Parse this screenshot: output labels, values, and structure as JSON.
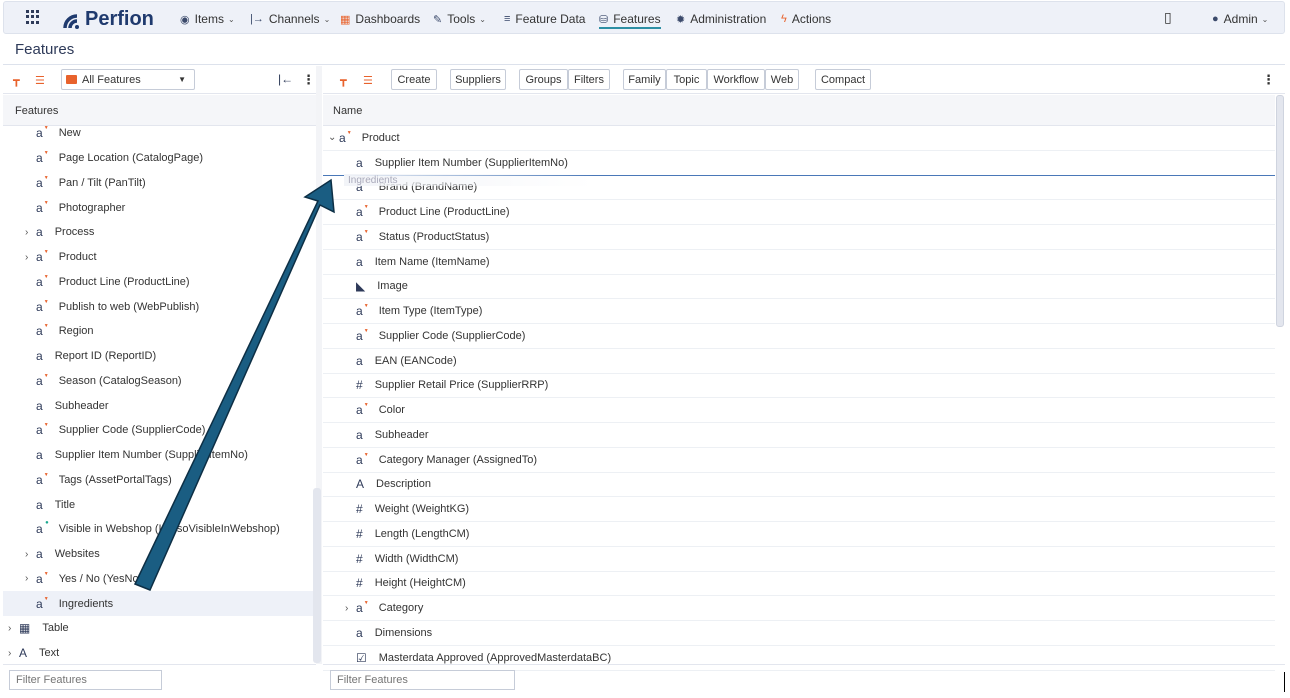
{
  "nav": {
    "brand": "Perfion",
    "items": [
      {
        "label": "Items",
        "icon": "cube-icon"
      },
      {
        "label": "Channels",
        "icon": "channel-icon"
      },
      {
        "label": "Dashboards",
        "icon": "dashboard-icon"
      },
      {
        "label": "Tools",
        "icon": "wrench-icon"
      },
      {
        "label": "Feature Data",
        "icon": "list-icon"
      },
      {
        "label": "Features",
        "icon": "database-icon"
      },
      {
        "label": "Administration",
        "icon": "gear-icon"
      },
      {
        "label": "Actions",
        "icon": "lightning-icon"
      }
    ],
    "user": "Admin"
  },
  "page_title": "Features",
  "left": {
    "select_value": "All Features",
    "column_header": "Features",
    "items": [
      {
        "label": "New",
        "icon": "a",
        "dd": true
      },
      {
        "label": "Page Location (CatalogPage)",
        "icon": "a",
        "dd": true
      },
      {
        "label": "Pan / Tilt (PanTilt)",
        "icon": "a",
        "dd": true
      },
      {
        "label": "Photographer",
        "icon": "a",
        "dd": true
      },
      {
        "label": "Process",
        "icon": "a",
        "chev": true
      },
      {
        "label": "Product",
        "icon": "a",
        "dd": true,
        "chev": true
      },
      {
        "label": "Product Line (ProductLine)",
        "icon": "a",
        "dd": true
      },
      {
        "label": "Publish to web (WebPublish)",
        "icon": "a",
        "dd": true
      },
      {
        "label": "Region",
        "icon": "a",
        "dd": true
      },
      {
        "label": "Report ID (ReportID)",
        "icon": "a"
      },
      {
        "label": "Season (CatalogSeason)",
        "icon": "a",
        "dd": true
      },
      {
        "label": "Subheader",
        "icon": "a"
      },
      {
        "label": "Supplier Code (SupplierCode)",
        "icon": "a",
        "dd": true
      },
      {
        "label": "Supplier Item Number (SupplierItemNo)",
        "icon": "a"
      },
      {
        "label": "Tags (AssetPortalTags)",
        "icon": "a",
        "dd": true
      },
      {
        "label": "Title",
        "icon": "a"
      },
      {
        "label": "Visible in Webshop (IsAlsoVisibleInWebshop)",
        "icon": "a",
        "dot": true
      },
      {
        "label": "Websites",
        "icon": "a",
        "chev": true
      },
      {
        "label": "Yes / No (YesNo)",
        "icon": "a",
        "dd": true,
        "chev": true
      },
      {
        "label": "Ingredients",
        "icon": "a",
        "dd": true,
        "selected": true
      }
    ],
    "root_items": [
      {
        "label": "Table",
        "icon": "▦"
      },
      {
        "label": "Text",
        "icon": "A"
      }
    ],
    "filter_placeholder": "Filter Features"
  },
  "right": {
    "toolbar": [
      "Create",
      "Suppliers",
      "Groups",
      "Filters",
      "Family",
      "Topic",
      "Workflow",
      "Web",
      "Compact"
    ],
    "column_header": "Name",
    "drag_ghost": "Ingredients",
    "rows": [
      {
        "label": "Product",
        "icon": "a",
        "dd": true,
        "expanded": true,
        "indent": 0
      },
      {
        "label": "Supplier Item Number (SupplierItemNo)",
        "icon": "a",
        "indent": 1
      },
      {
        "label": "Brand (BrandName)",
        "icon": "a",
        "dd": true,
        "indent": 1
      },
      {
        "label": "Product Line (ProductLine)",
        "icon": "a",
        "dd": true,
        "indent": 1
      },
      {
        "label": "Status (ProductStatus)",
        "icon": "a",
        "dd": true,
        "indent": 1
      },
      {
        "label": "Item Name (ItemName)",
        "icon": "a",
        "indent": 1
      },
      {
        "label": "Image",
        "icon": "◣",
        "indent": 1
      },
      {
        "label": "Item Type (ItemType)",
        "icon": "a",
        "dd": true,
        "indent": 1
      },
      {
        "label": "Supplier Code (SupplierCode)",
        "icon": "a",
        "dd": true,
        "indent": 1
      },
      {
        "label": "EAN (EANCode)",
        "icon": "a",
        "indent": 1
      },
      {
        "label": "Supplier Retail Price (SupplierRRP)",
        "icon": "#",
        "indent": 1
      },
      {
        "label": "Color",
        "icon": "a",
        "dd": true,
        "indent": 1
      },
      {
        "label": "Subheader",
        "icon": "a",
        "indent": 1
      },
      {
        "label": "Category Manager (AssignedTo)",
        "icon": "a",
        "dd": true,
        "indent": 1
      },
      {
        "label": "Description",
        "icon": "A",
        "indent": 1
      },
      {
        "label": "Weight (WeightKG)",
        "icon": "#",
        "indent": 1
      },
      {
        "label": "Length (LengthCM)",
        "icon": "#",
        "indent": 1
      },
      {
        "label": "Width (WidthCM)",
        "icon": "#",
        "indent": 1
      },
      {
        "label": "Height (HeightCM)",
        "icon": "#",
        "indent": 1
      },
      {
        "label": "Category",
        "icon": "a",
        "dd": true,
        "chev": true,
        "indent": 1
      },
      {
        "label": "Dimensions",
        "icon": "a",
        "indent": 1
      },
      {
        "label": "Masterdata Approved (ApprovedMasterdataBC)",
        "icon": "☑",
        "indent": 1
      }
    ],
    "filter_placeholder": "Filter Features"
  }
}
